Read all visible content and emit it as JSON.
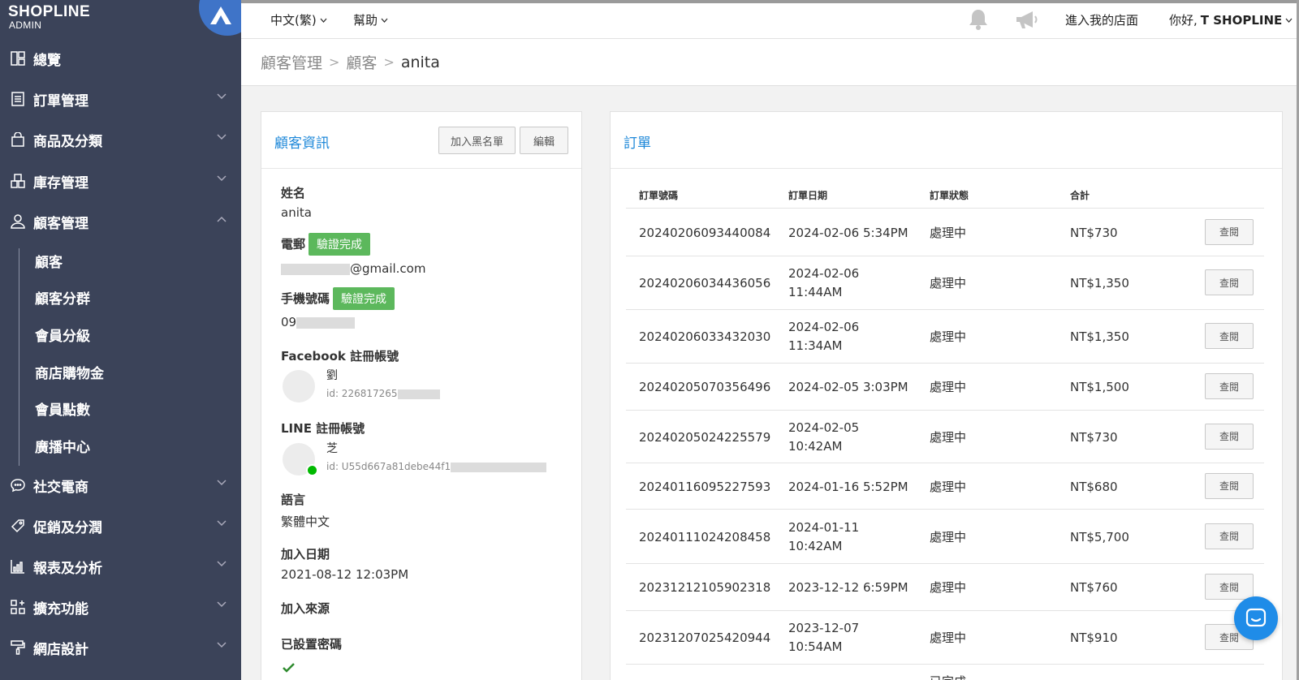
{
  "sidebar": {
    "logo": "SHOPLINE",
    "logo_sub": "ADMIN",
    "items": [
      {
        "label": "總覽",
        "icon": "dashboard-icon"
      },
      {
        "label": "訂單管理",
        "icon": "order-icon"
      },
      {
        "label": "商品及分類",
        "icon": "bag-icon"
      },
      {
        "label": "庫存管理",
        "icon": "inventory-icon"
      },
      {
        "label": "顧客管理",
        "icon": "user-icon"
      },
      {
        "label": "社交電商",
        "icon": "chat-icon"
      },
      {
        "label": "促銷及分潤",
        "icon": "tag-icon"
      },
      {
        "label": "報表及分析",
        "icon": "chart-icon"
      },
      {
        "label": "擴充功能",
        "icon": "apps-icon"
      },
      {
        "label": "網店設計",
        "icon": "brush-icon"
      }
    ],
    "customer_sub": [
      "顧客",
      "顧客分群",
      "會員分級",
      "商店購物金",
      "會員點數",
      "廣播中心"
    ]
  },
  "topbar": {
    "language": "中文(繁)",
    "help": "幫助",
    "store_link": "進入我的店面",
    "greeting_prefix": "你好,",
    "greeting_name": "T SHOPLINE"
  },
  "breadcrumb": {
    "level1": "顧客管理",
    "level2": "顧客",
    "current": "anita"
  },
  "customer": {
    "title": "顧客資訊",
    "blacklist_button": "加入黑名單",
    "edit_button": "編輯",
    "name_label": "姓名",
    "name_value": "anita",
    "email_label": "電郵",
    "verified_badge": "驗證完成",
    "email_value": "@gmail.com",
    "phone_label": "手機號碼",
    "phone_value": "09",
    "facebook_label": "Facebook 註冊帳號",
    "facebook_name": "劉",
    "facebook_id": "id: 226817265",
    "line_label": "LINE 註冊帳號",
    "line_name": "芝",
    "line_id": "id: U55d667a81debe44f1",
    "language_label": "語言",
    "language_value": "繁體中文",
    "join_date_label": "加入日期",
    "join_date_value": "2021-08-12 12:03PM",
    "join_source_label": "加入來源",
    "password_label": "已設置密碼"
  },
  "orders": {
    "title": "訂單",
    "columns": [
      "訂單號碼",
      "訂單日期",
      "訂單狀態",
      "合計"
    ],
    "view_label": "查閱",
    "rows": [
      {
        "no": "20240206093440084",
        "date1": "2024-02-06 5:34PM",
        "date2": "",
        "status": "處理中",
        "total": "NT$730"
      },
      {
        "no": "20240206034436056",
        "date1": "2024-02-06",
        "date2": "11:44AM",
        "status": "處理中",
        "total": "NT$1,350"
      },
      {
        "no": "20240206033432030",
        "date1": "2024-02-06",
        "date2": "11:34AM",
        "status": "處理中",
        "total": "NT$1,350"
      },
      {
        "no": "20240205070356496",
        "date1": "2024-02-05 3:03PM",
        "date2": "",
        "status": "處理中",
        "total": "NT$1,500"
      },
      {
        "no": "20240205024225579",
        "date1": "2024-02-05",
        "date2": "10:42AM",
        "status": "處理中",
        "total": "NT$730"
      },
      {
        "no": "20240116095227593",
        "date1": "2024-01-16 5:52PM",
        "date2": "",
        "status": "處理中",
        "total": "NT$680"
      },
      {
        "no": "20240111024208458",
        "date1": "2024-01-11",
        "date2": "10:42AM",
        "status": "處理中",
        "total": "NT$5,700"
      },
      {
        "no": "20231212105902318",
        "date1": "2023-12-12 6:59PM",
        "date2": "",
        "status": "處理中",
        "total": "NT$760"
      },
      {
        "no": "20231207025420944",
        "date1": "2023-12-07",
        "date2": "10:54AM",
        "status": "處理中",
        "total": "NT$910"
      }
    ],
    "partial_status": "已完成"
  }
}
